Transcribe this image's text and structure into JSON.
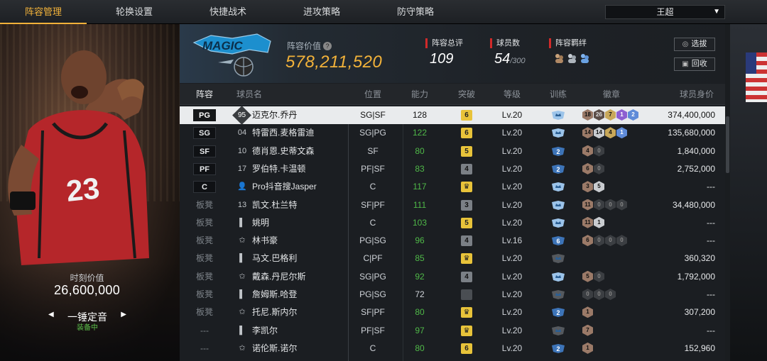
{
  "tabs": [
    "阵容管理",
    "轮换设置",
    "快捷战术",
    "进攻策略",
    "防守策略"
  ],
  "team_selector": {
    "value": "王超"
  },
  "left_panel": {
    "moment_value_label": "时刻价值",
    "moment_value": "26,600,000",
    "skin_name": "一锤定音",
    "skin_status": "装备中"
  },
  "banner": {
    "lineup_value_label": "阵容价值",
    "lineup_value": "578,211,520",
    "rating_label": "阵容总评",
    "rating": "109",
    "players_label": "球员数",
    "players_count": "54",
    "players_max": "/300",
    "bond_label": "阵容羁绊",
    "btn_select": "选拔",
    "btn_recycle": "回收"
  },
  "columns": [
    "阵容",
    "球员名",
    "位置",
    "能力",
    "突破",
    "等级",
    "训练",
    "徽章",
    "球员身价"
  ],
  "rows": [
    {
      "role": "PG",
      "num": "95",
      "name": "迈克尔.乔丹",
      "pos": "SG|SF",
      "ability": "128",
      "ability_color": "white",
      "breakthrough": "6",
      "break_style": "gold",
      "level": "Lv.20",
      "training": "crown",
      "badges": [
        [
          "br",
          "18"
        ],
        [
          "dk",
          "26"
        ],
        [
          "gd",
          "7"
        ],
        [
          "pu",
          "1"
        ],
        [
          "bl",
          "2"
        ]
      ],
      "value": "374,400,000"
    },
    {
      "role": "SG",
      "num": "04",
      "name": "特雷西.麦格雷迪",
      "pos": "SG|PG",
      "ability": "122",
      "ability_color": "green",
      "breakthrough": "6",
      "break_style": "gold",
      "level": "Lv.20",
      "training": "crown",
      "badges": [
        [
          "br",
          "14"
        ],
        [
          "sv",
          "14"
        ],
        [
          "gd",
          "4"
        ],
        [
          "bl",
          "1"
        ]
      ],
      "value": "135,680,000"
    },
    {
      "role": "SF",
      "num": "10",
      "name": "德肖恩.史蒂文森",
      "pos": "SF",
      "ability": "80",
      "ability_color": "green",
      "breakthrough": "5",
      "break_style": "gold",
      "level": "Lv.20",
      "training": "2",
      "badges": [
        [
          "br",
          "4"
        ],
        [
          "nil",
          "0"
        ]
      ],
      "value": "1,840,000"
    },
    {
      "role": "PF",
      "num": "17",
      "name": "罗伯特.卡温顿",
      "pos": "PF|SF",
      "ability": "83",
      "ability_color": "green",
      "breakthrough": "4",
      "break_style": "gray",
      "level": "Lv.20",
      "training": "2",
      "badges": [
        [
          "br",
          "6"
        ],
        [
          "nil",
          "0"
        ]
      ],
      "value": "2,752,000"
    },
    {
      "role": "C",
      "num": "",
      "name": "Pro抖音搜Jasper",
      "pos": "C",
      "ability": "117",
      "ability_color": "green",
      "breakthrough": "",
      "break_style": "gold",
      "level": "Lv.20",
      "training": "crown",
      "badges": [
        [
          "br",
          "3"
        ],
        [
          "sv",
          "5"
        ]
      ],
      "value": "---"
    },
    {
      "role": "板凳",
      "num": "13",
      "name": "凯文.杜兰特",
      "pos": "SF|PF",
      "ability": "111",
      "ability_color": "green",
      "breakthrough": "3",
      "break_style": "gray",
      "level": "Lv.20",
      "training": "crown",
      "badges": [
        [
          "br",
          "11"
        ],
        [
          "nil",
          "0"
        ],
        [
          "nil",
          "0"
        ],
        [
          "nil",
          "0"
        ]
      ],
      "value": "34,480,000"
    },
    {
      "role": "板凳",
      "num": "",
      "name": "姚明",
      "pos": "C",
      "ability": "103",
      "ability_color": "green",
      "breakthrough": "5",
      "break_style": "gold",
      "level": "Lv.20",
      "training": "crown",
      "badges": [
        [
          "br",
          "11"
        ],
        [
          "sv",
          "1"
        ]
      ],
      "value": "---"
    },
    {
      "role": "板凳",
      "num": "",
      "name": "林书豪",
      "pos": "PG|SG",
      "ability": "96",
      "ability_color": "green",
      "breakthrough": "4",
      "break_style": "gray",
      "level": "Lv.16",
      "training": "6",
      "badges": [
        [
          "br",
          "6"
        ],
        [
          "nil",
          "0"
        ],
        [
          "nil",
          "0"
        ],
        [
          "nil",
          "0"
        ]
      ],
      "value": "---"
    },
    {
      "role": "板凳",
      "num": "",
      "name": "马文.巴格利",
      "pos": "C|PF",
      "ability": "85",
      "ability_color": "green",
      "breakthrough": "",
      "break_style": "gold",
      "level": "Lv.20",
      "training": "dim",
      "badges": [],
      "value": "360,320"
    },
    {
      "role": "板凳",
      "num": "",
      "name": "戴森.丹尼尔斯",
      "pos": "SG|PG",
      "ability": "92",
      "ability_color": "green",
      "breakthrough": "4",
      "break_style": "gray",
      "level": "Lv.20",
      "training": "crown",
      "badges": [
        [
          "br",
          "5"
        ],
        [
          "nil",
          "0"
        ]
      ],
      "value": "1,792,000"
    },
    {
      "role": "板凳",
      "num": "",
      "name": "詹姆斯.哈登",
      "pos": "PG|SG",
      "ability": "72",
      "ability_color": "white",
      "breakthrough": "",
      "break_style": "dgray",
      "level": "Lv.20",
      "training": "dim",
      "badges": [
        [
          "nil",
          "0"
        ],
        [
          "nil",
          "0"
        ],
        [
          "nil",
          "0"
        ]
      ],
      "value": "---"
    },
    {
      "role": "板凳",
      "num": "",
      "name": "托尼.斯内尔",
      "pos": "SF|PF",
      "ability": "80",
      "ability_color": "green",
      "breakthrough": "",
      "break_style": "gold",
      "level": "Lv.20",
      "training": "2",
      "badges": [
        [
          "br",
          "1"
        ]
      ],
      "value": "307,200"
    },
    {
      "role": "---",
      "num": "",
      "name": "李凯尔",
      "pos": "PF|SF",
      "ability": "97",
      "ability_color": "green",
      "breakthrough": "",
      "break_style": "gold",
      "level": "Lv.20",
      "training": "dim",
      "badges": [
        [
          "br",
          "7"
        ]
      ],
      "value": "---"
    },
    {
      "role": "---",
      "num": "",
      "name": "诺伦斯.诺尔",
      "pos": "C",
      "ability": "80",
      "ability_color": "green",
      "breakthrough": "6",
      "break_style": "gold",
      "level": "Lv.20",
      "training": "2",
      "badges": [
        [
          "br",
          "1"
        ]
      ],
      "value": "152,960"
    }
  ]
}
